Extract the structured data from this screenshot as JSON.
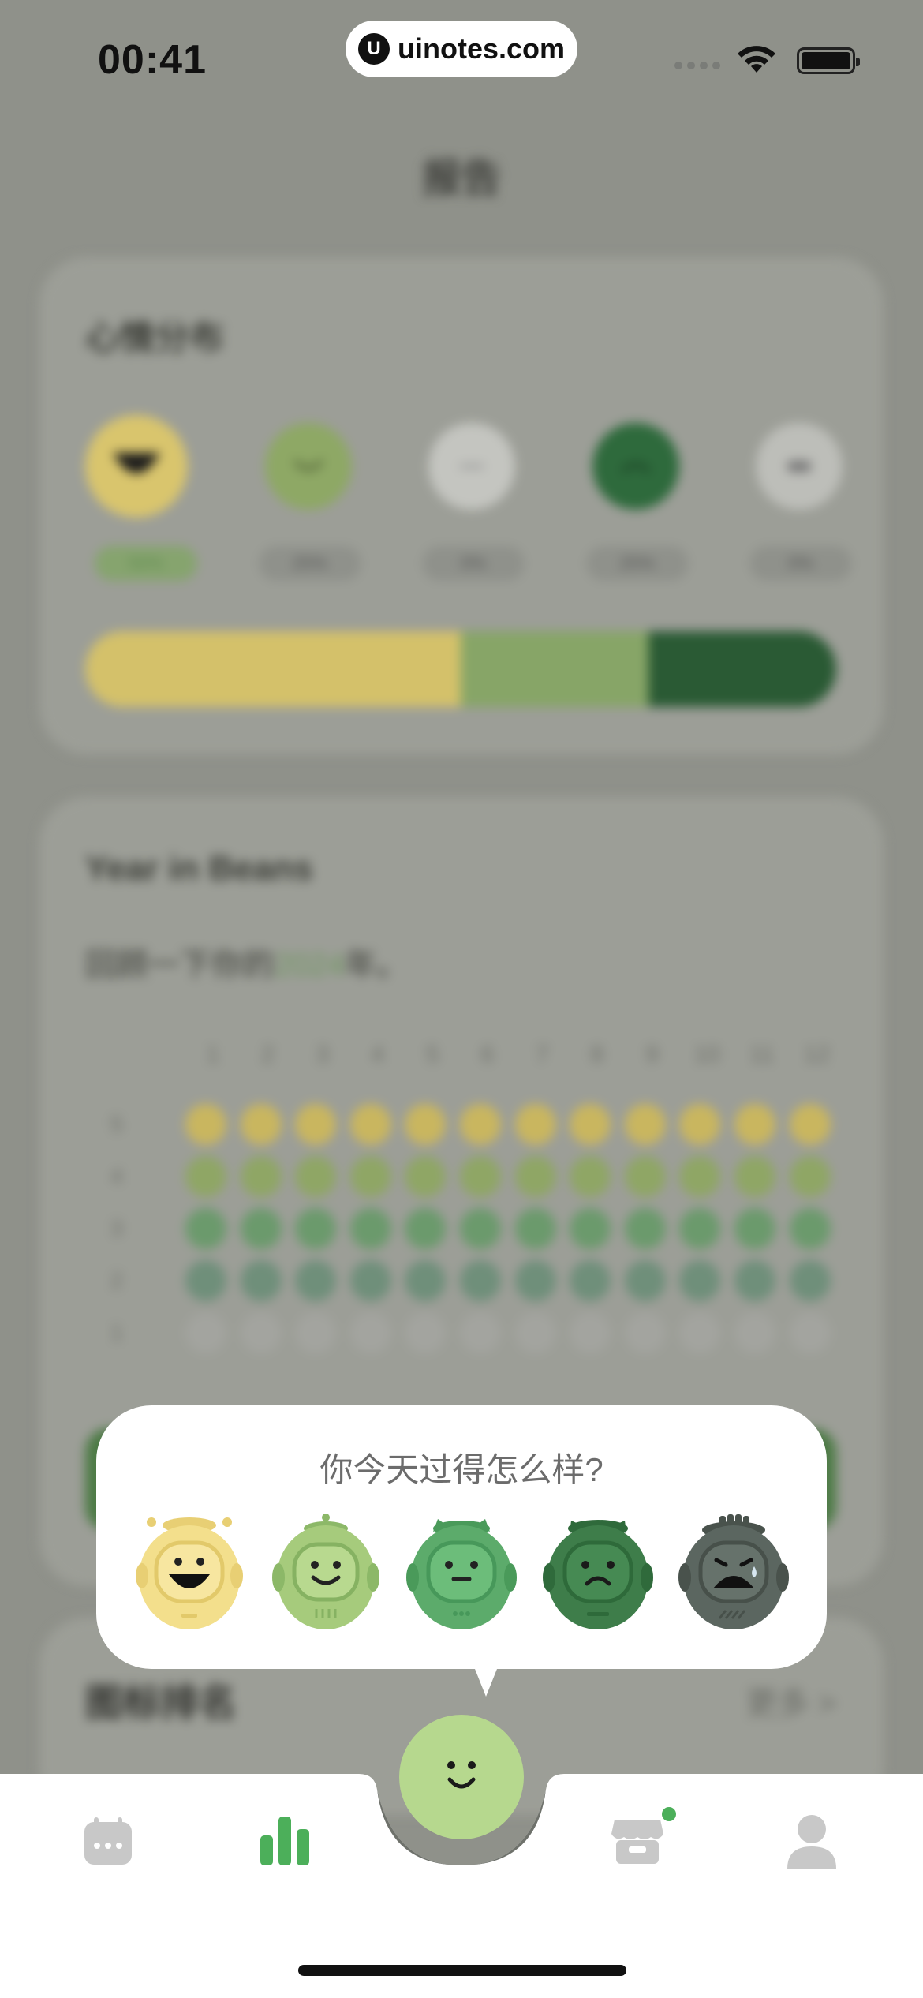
{
  "status_bar": {
    "time": "00:41",
    "watermark": "uinotes.com"
  },
  "page": {
    "title": "报告"
  },
  "mood_card": {
    "title": "心情分布",
    "moods": [
      {
        "icon": "very-happy-face-icon",
        "color": "#d9c56d",
        "percent": "50%"
      },
      {
        "icon": "happy-face-icon",
        "color": "#8ea865",
        "percent": "25%"
      },
      {
        "icon": "neutral-face-icon",
        "color": "#c4c5c0",
        "percent": "0%"
      },
      {
        "icon": "sad-face-icon",
        "color": "#2e6a3c",
        "percent": "25%"
      },
      {
        "icon": "crying-face-icon",
        "color": "#bdbeb9",
        "percent": "0%"
      }
    ],
    "distribution_bar": [
      {
        "color": "#d4c16a",
        "share": 0.5
      },
      {
        "color": "#87a567",
        "share": 0.25
      },
      {
        "color": "#2a5a34",
        "share": 0.25
      }
    ]
  },
  "year_card": {
    "title": "Year in Beans",
    "subtitle_before": "回顾一下你的",
    "subtitle_year": "2024",
    "subtitle_after": "年。",
    "months": [
      "1",
      "2",
      "3",
      "4",
      "5",
      "6",
      "7",
      "8",
      "9",
      "10",
      "11",
      "12"
    ],
    "rows": [
      {
        "label": "5",
        "color": "#c9b65f"
      },
      {
        "label": "4",
        "color": "#8fa665"
      },
      {
        "label": "3",
        "color": "#6b9a6c"
      },
      {
        "label": "2",
        "color": "#6f8f7a"
      },
      {
        "label": "1",
        "color": "#a3a49f"
      }
    ]
  },
  "rank_card": {
    "title": "图标排名",
    "more": "更多 >"
  },
  "popover": {
    "question": "你今天过得怎么样?",
    "options": [
      {
        "name": "mood-option-great",
        "icon": "great-robot-icon",
        "color": "#f3df8c"
      },
      {
        "name": "mood-option-good",
        "icon": "good-robot-icon",
        "color": "#a6cb7c"
      },
      {
        "name": "mood-option-okay",
        "icon": "okay-robot-icon",
        "color": "#5cab6b"
      },
      {
        "name": "mood-option-bad",
        "icon": "bad-robot-icon",
        "color": "#3e7d4a"
      },
      {
        "name": "mood-option-awful",
        "icon": "awful-robot-icon",
        "color": "#5b6660"
      }
    ]
  },
  "tabbar": {
    "tabs": [
      {
        "name": "tab-calendar",
        "icon": "calendar-icon",
        "active": false
      },
      {
        "name": "tab-report",
        "icon": "bar-chart-icon",
        "active": true
      },
      {
        "name": "tab-add-mood",
        "icon": "smile-icon",
        "active": false
      },
      {
        "name": "tab-store",
        "icon": "store-icon",
        "active": false
      },
      {
        "name": "tab-profile",
        "icon": "person-icon",
        "active": false
      }
    ],
    "active_color": "#4caf5a",
    "inactive_color": "#c8c8c8"
  }
}
